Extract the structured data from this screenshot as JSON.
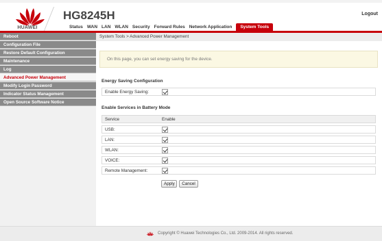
{
  "header": {
    "brand": "HUAWEI",
    "model": "HG8245H",
    "logout_label": "Logout",
    "accent_color": "#c7000b",
    "logo_icon": "huawei-flower-logo-icon"
  },
  "nav": {
    "tabs": [
      "Status",
      "WAN",
      "LAN",
      "WLAN",
      "Security",
      "Forward Rules",
      "Network Application",
      "System Tools"
    ],
    "active": "System Tools"
  },
  "sidebar": {
    "items": [
      "Reboot",
      "Configuration File",
      "Restore Default Configuration",
      "Maintenance",
      "Log",
      "Advanced Power Management",
      "Modify Login Password",
      "Indicator Status Management",
      "Open Source Software Notice"
    ],
    "active": "Advanced Power Management"
  },
  "main": {
    "breadcrumb": "System Tools > Advanced Power Management",
    "notice": "On this page, you can set energy saving for the device.",
    "energy_section": {
      "title": "Energy Saving Configuration",
      "label": "Enable Energy Saving:",
      "checked": true
    },
    "battery_section": {
      "title": "Enable Services in Battery Mode",
      "col_service": "Service",
      "col_enable": "Enable",
      "rows": [
        {
          "label": "USB:",
          "checked": true
        },
        {
          "label": "LAN:",
          "checked": true
        },
        {
          "label": "WLAN:",
          "checked": true
        },
        {
          "label": "VOICE:",
          "checked": true
        },
        {
          "label": "Remote Management:",
          "checked": true
        }
      ]
    },
    "apply_label": "Apply",
    "cancel_label": "Cancel"
  },
  "footer": {
    "copyright": "Copyright © Huawei Technologies Co., Ltd. 2009-2014. All rights reserved."
  }
}
